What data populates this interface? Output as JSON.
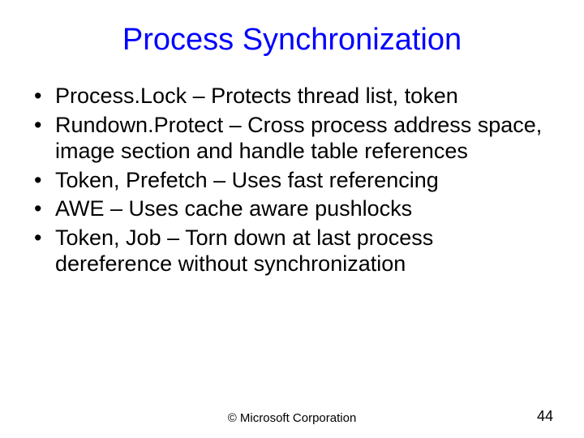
{
  "title": "Process Synchronization",
  "bullets": [
    "Process.Lock – Protects thread list, token",
    "Rundown.Protect – Cross process address space, image section and handle table references",
    "Token, Prefetch – Uses fast referencing",
    "AWE – Uses cache aware pushlocks",
    "Token, Job – Torn down at last process dereference without synchronization"
  ],
  "footer": {
    "copyright": "© Microsoft Corporation",
    "page_number": "44"
  }
}
